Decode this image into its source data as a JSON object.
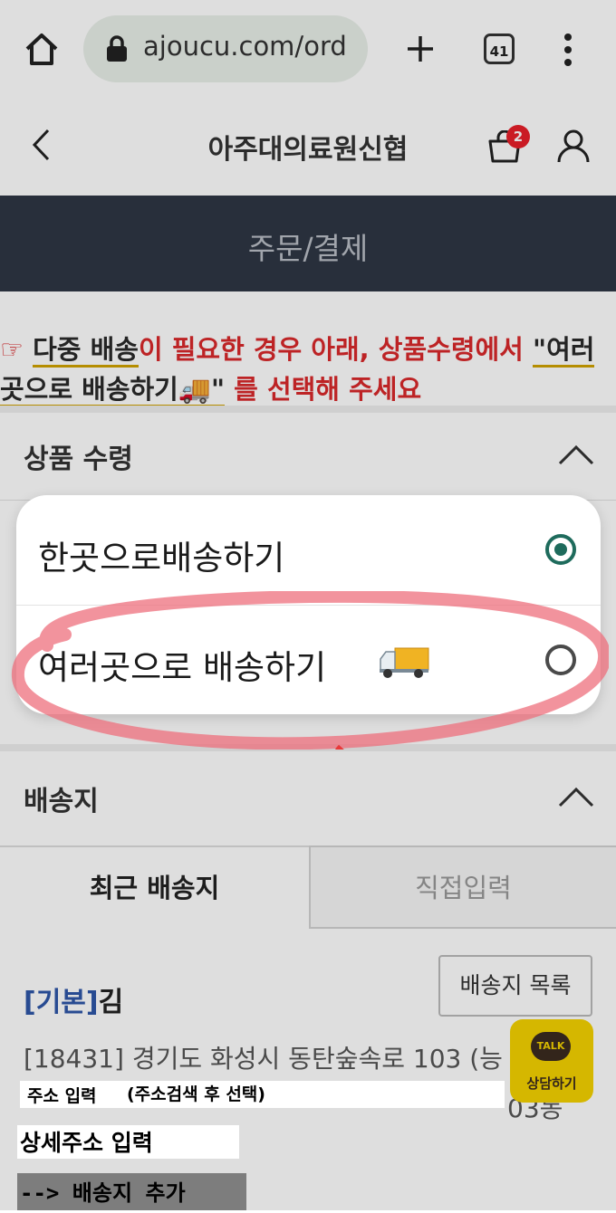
{
  "browser": {
    "url": "ajoucu.com/ord",
    "tab_count": "41"
  },
  "header": {
    "title": "아주대의료원신협",
    "cart_badge": "2"
  },
  "order_bar": {
    "title": "주문/결제"
  },
  "notice": {
    "pointer": "☞",
    "part1": "다중 배송",
    "part2": "이 필요한 경우 아래, 상품수령에서 ",
    "part3": "\"여러곳으로 배송하기🚚\"",
    "part4": " 를 선택해 주세요"
  },
  "receipt_section": {
    "title": "상품 수령"
  },
  "dialog": {
    "options": [
      {
        "label": "한곳으로배송하기",
        "selected": true
      },
      {
        "label": "여러곳으로 배송하기",
        "selected": false
      }
    ]
  },
  "shipping_section": {
    "title": "배송지",
    "tabs": [
      {
        "label": "최근 배송지",
        "active": true
      },
      {
        "label": "직접입력",
        "active": false
      }
    ],
    "address_tag": "[기본]",
    "address_name": "김",
    "address_list_button": "배송지 목록",
    "address_line": "[18431] 경기도 화성시 동탄숲속로 103 (능",
    "address_line_tail": "03동"
  },
  "kakao": {
    "bubble": "TALK",
    "label": "상담하기"
  },
  "annotations": {
    "address_input": "주소 입력",
    "address_hint": "(주소검색 후 선택)",
    "detail_address": "상세주소 입력",
    "add_address": "--> 배송지 추가"
  },
  "colors": {
    "order_bar": "#2f3744",
    "notice_red": "#d9292b",
    "radio_green": "#1e6b5c",
    "kakao_yellow": "#f5d300",
    "tag_blue": "#2f57a8"
  }
}
